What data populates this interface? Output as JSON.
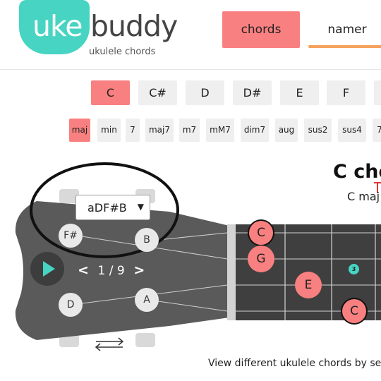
{
  "header": {
    "logo_uke": "uke",
    "logo_buddy": "buddy",
    "logo_subtitle": "ukulele chords",
    "nav": [
      {
        "label": "chords",
        "active": true
      },
      {
        "label": "namer",
        "active": false
      }
    ]
  },
  "roots": {
    "items": [
      "C",
      "C#",
      "D",
      "D#",
      "E",
      "F"
    ],
    "selected": "C"
  },
  "qualities": {
    "items": [
      "maj",
      "min",
      "7",
      "maj7",
      "m7",
      "mM7",
      "dim7",
      "aug",
      "sus2",
      "sus4",
      "7"
    ],
    "selected": "maj"
  },
  "chord": {
    "title": "C cho",
    "subtitle": "C maj"
  },
  "tuning": {
    "selected": "aDF#B",
    "arrow": "▼"
  },
  "headstock": {
    "pegs": {
      "top_left": "F#",
      "top_right": "B",
      "bottom_left": "D",
      "bottom_right": "A"
    }
  },
  "voicing": {
    "prev": "<",
    "count": "1 / 9",
    "next": ">"
  },
  "fretboard": {
    "notes": [
      "C",
      "G",
      "E",
      "C"
    ],
    "finger_number": "3"
  },
  "footer": {
    "text": "View different ukulele chords by se"
  },
  "colors": {
    "accent_teal": "#47d4c2",
    "accent_coral": "#f98080",
    "accent_orange": "#f5a25d",
    "headstock": "#5a5a5a",
    "fretboard": "#3f3f3f"
  }
}
